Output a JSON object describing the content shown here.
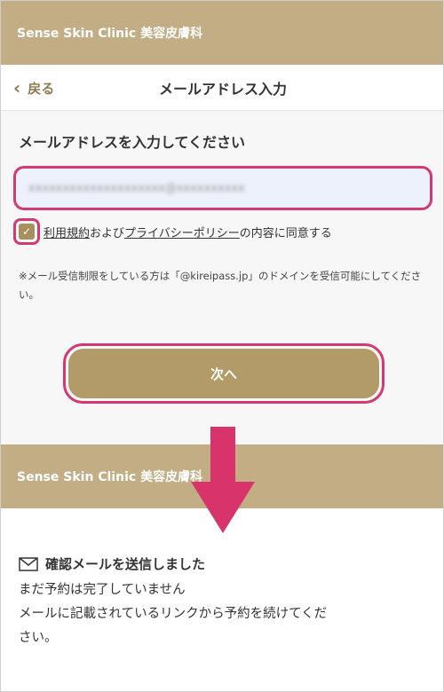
{
  "header": {
    "clinic_name": "Sense Skin Clinic 美容皮膚科"
  },
  "nav": {
    "back_label": "戻る",
    "title": "メールアドレス入力"
  },
  "form": {
    "heading": "メールアドレスを入力してください",
    "email_value": "xxxxxxxxxxxxxxxxxxxx@xxxxxxxxxx",
    "terms_link": "利用規約",
    "and_text": " および",
    "privacy_link": "プライバシーポリシー",
    "agree_suffix": "の内容に同意する",
    "notice": "※メール受信制限をしている方は「@kireipass.jp」のドメインを受信可能にしてください。",
    "next_label": "次へ"
  },
  "confirm": {
    "clinic_name": "Sense Skin Clinic 美容皮膚科",
    "title": "確認メールを送信しました",
    "line1": "まだ予約は完了していません",
    "line2": "メールに記載されているリンクから予約を続けてくだ",
    "line3": "さい。"
  },
  "colors": {
    "brand_gold": "#c2ad85",
    "highlight_pink": "#d33a6f",
    "button_gold": "#b39b69"
  }
}
